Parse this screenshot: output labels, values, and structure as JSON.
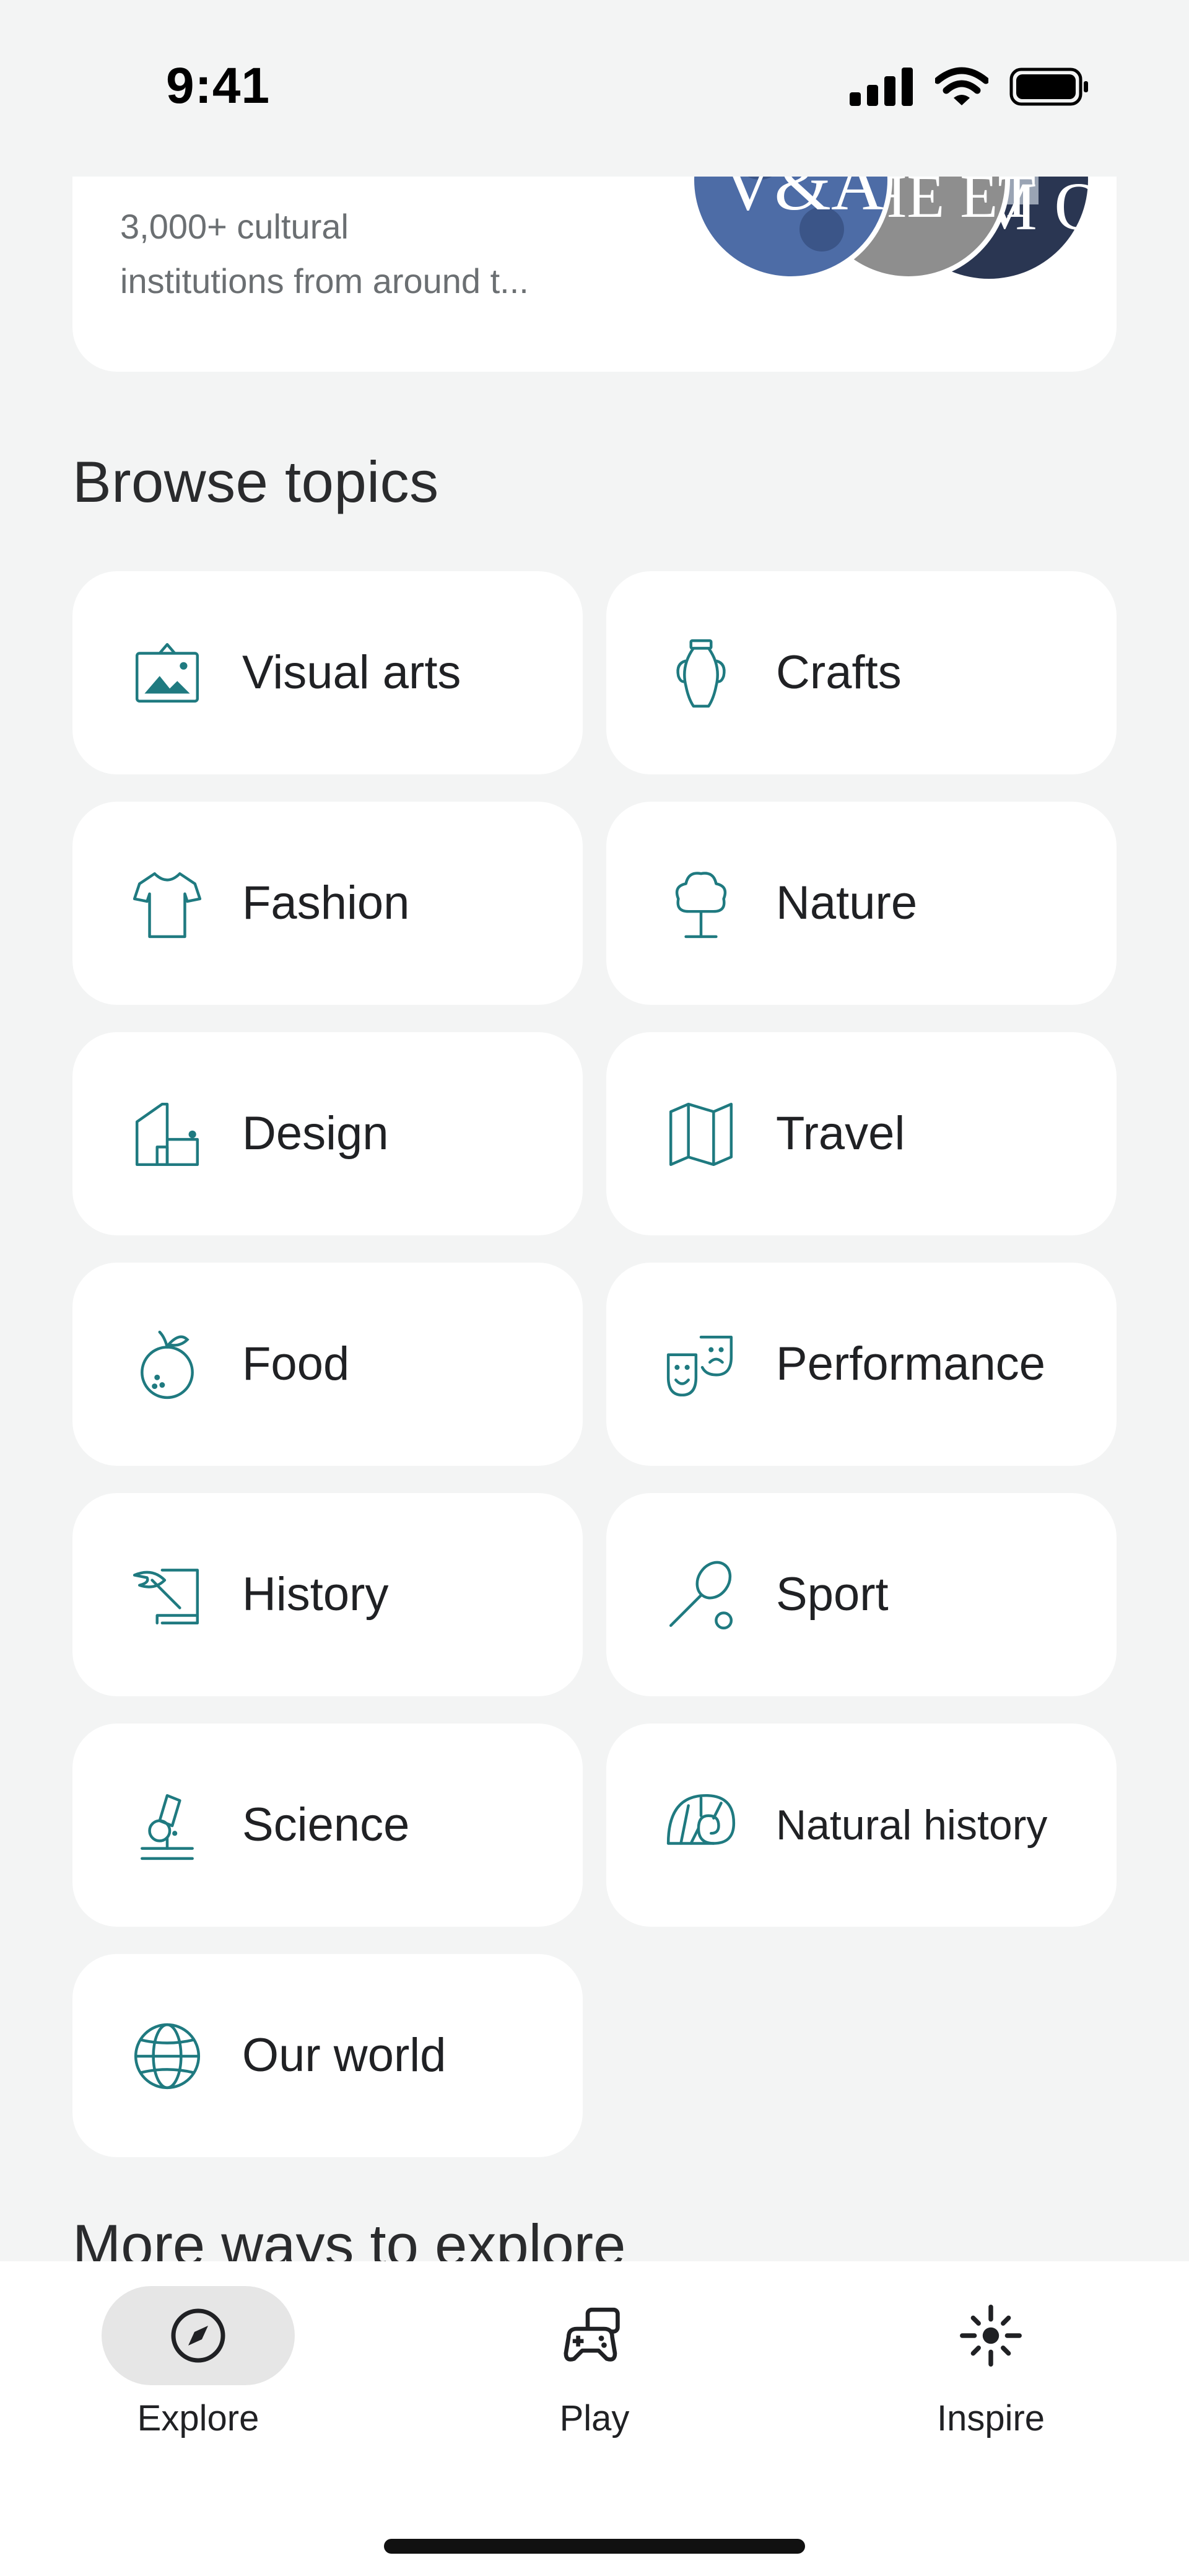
{
  "status": {
    "time": "9:41"
  },
  "institutions": {
    "description_line1": "3,000+ cultural",
    "description_line2": "institutions from around t...",
    "logo1": "V&A",
    "logo2": "HE ET",
    "logo3": "M O"
  },
  "browse": {
    "title": "Browse topics",
    "topics": [
      {
        "label": "Visual arts",
        "icon": "picture-frame-icon"
      },
      {
        "label": "Crafts",
        "icon": "vase-icon"
      },
      {
        "label": "Fashion",
        "icon": "tshirt-icon"
      },
      {
        "label": "Nature",
        "icon": "tree-icon"
      },
      {
        "label": "Design",
        "icon": "building-icon"
      },
      {
        "label": "Travel",
        "icon": "map-icon"
      },
      {
        "label": "Food",
        "icon": "fruit-icon"
      },
      {
        "label": "Performance",
        "icon": "theater-masks-icon"
      },
      {
        "label": "History",
        "icon": "scroll-quill-icon"
      },
      {
        "label": "Sport",
        "icon": "racket-icon"
      },
      {
        "label": "Science",
        "icon": "microscope-icon"
      },
      {
        "label": "Natural history",
        "icon": "nautilus-shell-icon"
      },
      {
        "label": "Our world",
        "icon": "globe-icon"
      }
    ]
  },
  "more": {
    "title": "More ways to explore"
  },
  "nav": {
    "explore": "Explore",
    "play": "Play",
    "inspire": "Inspire"
  },
  "colors": {
    "accent": "#1f7a80",
    "background": "#f3f4f4",
    "card": "#ffffff"
  }
}
